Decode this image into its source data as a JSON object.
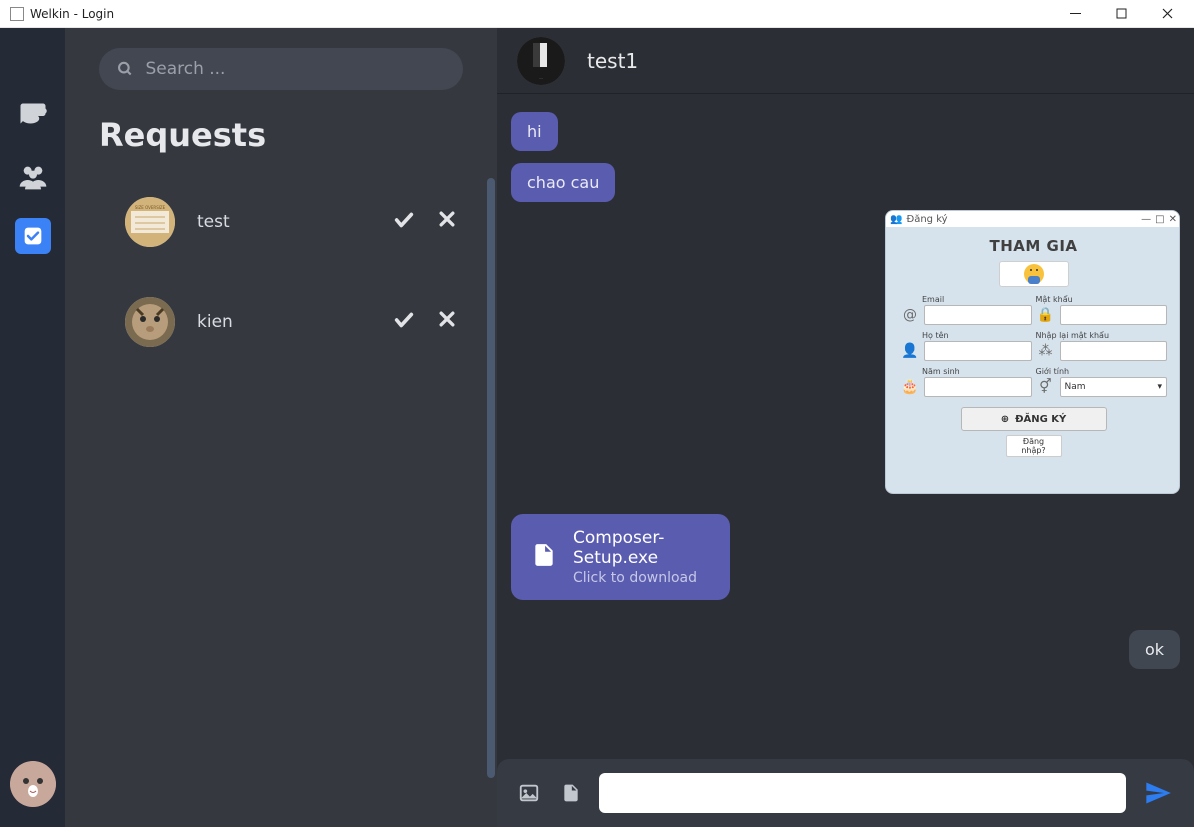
{
  "window": {
    "title": "Welkin - Login"
  },
  "search": {
    "placeholder": "Search ..."
  },
  "sidebar": {
    "title": "Requests",
    "requests": [
      {
        "name": "test"
      },
      {
        "name": "kien"
      }
    ]
  },
  "chat": {
    "header_name": "test1",
    "messages": {
      "m1": "hi",
      "m2": "chao cau",
      "m3": "ok"
    },
    "file": {
      "name": "Composer-Setup.exe",
      "subtitle": "Click to download"
    },
    "embedded_dialog": {
      "window_title": "Đăng ký",
      "heading": "THAM GIA",
      "labels": {
        "email": "Email",
        "password": "Mật khẩu",
        "fullname": "Họ tên",
        "confirm": "Nhập lại mật khẩu",
        "birthyear": "Năm sinh",
        "gender": "Giới tính"
      },
      "gender_value": "Nam",
      "submit": "ĐĂNG KÝ",
      "login_link": "Đăng nhập?"
    }
  },
  "icons": {
    "chat": "chat-icon",
    "group": "group-icon",
    "requests": "check-icon"
  }
}
